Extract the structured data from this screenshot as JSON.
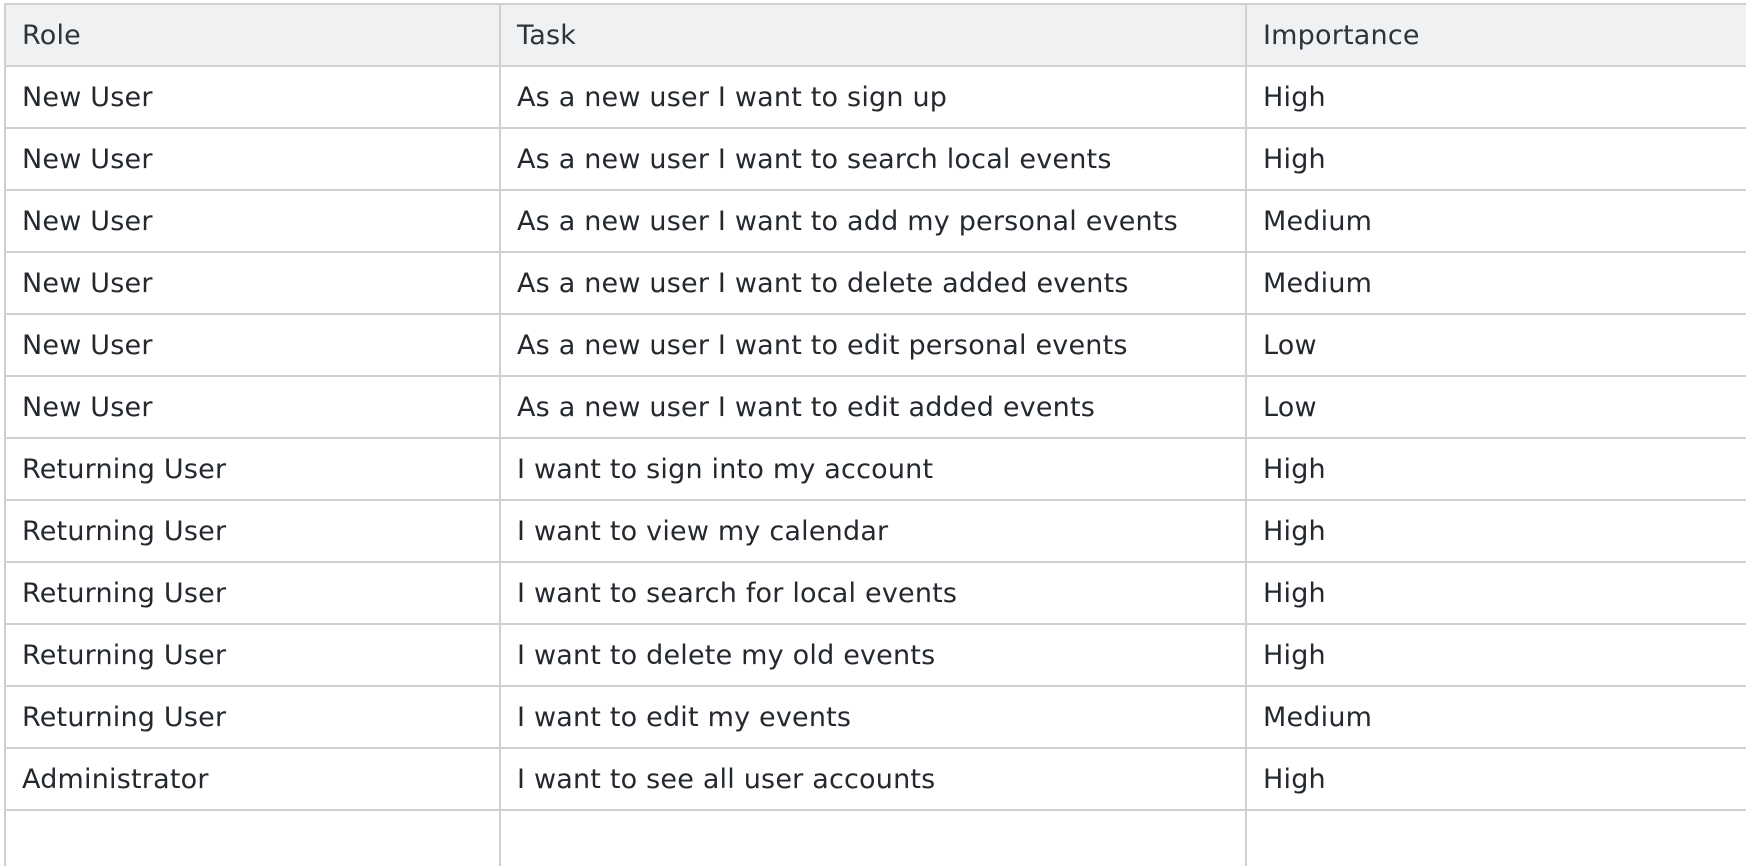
{
  "table": {
    "headers": [
      "Role",
      "Task",
      "Importance"
    ],
    "rows": [
      [
        "New User",
        "As a new user I want to sign up",
        "High"
      ],
      [
        "New User",
        "As a new user I want to search local events",
        "High"
      ],
      [
        "New User",
        "As a new user I want to add my personal events",
        "Medium"
      ],
      [
        "New User",
        "As a new user I want to delete added events",
        "Medium"
      ],
      [
        "New User",
        "As a new user I want to edit personal events",
        "Low"
      ],
      [
        "New User",
        "As a new user I want to edit added events",
        "Low"
      ],
      [
        "Returning User",
        "I want to sign into my account",
        "High"
      ],
      [
        "Returning User",
        "I want to view my calendar",
        "High"
      ],
      [
        "Returning User",
        "I want to search for local events",
        "High"
      ],
      [
        "Returning User",
        "I want to delete my old events",
        "High"
      ],
      [
        "Returning User",
        "I want to edit my events",
        "Medium"
      ],
      [
        "Administrator",
        "I want to see all user accounts",
        "High"
      ],
      [
        "",
        "",
        ""
      ]
    ]
  }
}
